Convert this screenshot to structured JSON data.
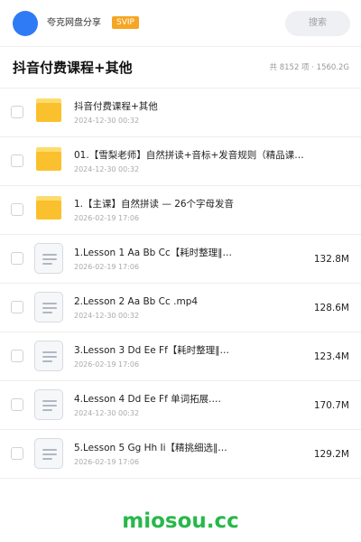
{
  "header": {
    "share_name": "夸克网盘分享",
    "badge": "SVIP",
    "search_placeholder": "搜索",
    "avatar_color": "#2f7bf6",
    "badge_color": "#f5a623"
  },
  "folder": {
    "title": "抖音付费课程+其他",
    "summary": "共 8152 项 · 1560.2G"
  },
  "items": [
    {
      "type": "folder",
      "icon": "folder-icon",
      "name": "抖音付费课程+其他",
      "date": "2024-12-30 00:32",
      "size": ""
    },
    {
      "type": "folder",
      "icon": "folder-icon",
      "name": "01.【雪梨老师】自然拼读+音标+发音规则（精品课…",
      "date": "2024-12-30 00:32",
      "size": ""
    },
    {
      "type": "folder",
      "icon": "folder-icon",
      "name": "1.【主课】自然拼读 — 26个字母发音",
      "date": "2026-02-19 17:06",
      "size": ""
    },
    {
      "type": "file",
      "icon": "document-icon",
      "name": "1.Lesson 1 Aa Bb Cc【耗时整理‖…",
      "date": "2026-02-19 17:06",
      "size": "132.8M"
    },
    {
      "type": "file",
      "icon": "document-icon",
      "name": "2.Lesson 2 Aa Bb Cc .mp4",
      "date": "2024-12-30 00:32",
      "size": "128.6M"
    },
    {
      "type": "file",
      "icon": "document-icon",
      "name": "3.Lesson 3 Dd Ee Ff【耗时整理‖…",
      "date": "2026-02-19 17:06",
      "size": "123.4M"
    },
    {
      "type": "file",
      "icon": "document-icon",
      "name": "4.Lesson 4 Dd Ee Ff 单词拓展.…",
      "date": "2024-12-30 00:32",
      "size": "170.7M"
    },
    {
      "type": "file",
      "icon": "document-icon",
      "name": "5.Lesson 5 Gg Hh Ii【精挑细选‖…",
      "date": "2026-02-19 17:06",
      "size": "129.2M"
    }
  ],
  "watermark": {
    "text": "miosou.cc",
    "color": "#27b84a"
  }
}
